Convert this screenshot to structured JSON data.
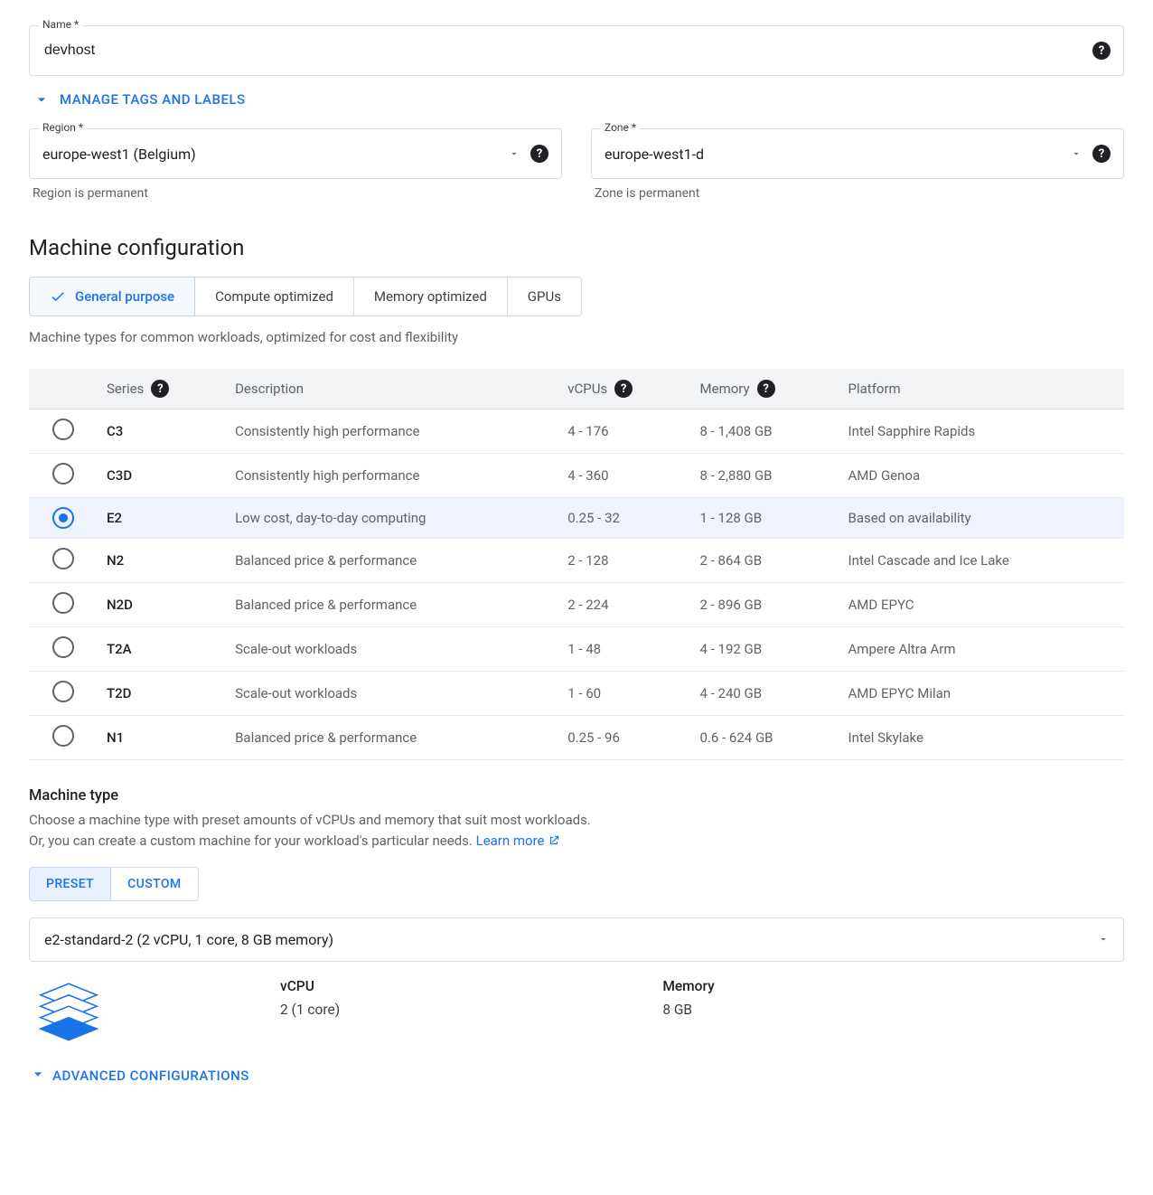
{
  "name_field": {
    "label": "Name",
    "value": "devhost"
  },
  "manage_tags_label": "MANAGE TAGS AND LABELS",
  "region_field": {
    "label": "Region",
    "value": "europe-west1 (Belgium)",
    "helper": "Region is permanent"
  },
  "zone_field": {
    "label": "Zone",
    "value": "europe-west1-d",
    "helper": "Zone is permanent"
  },
  "machine_config_title": "Machine configuration",
  "tabs": {
    "general": "General purpose",
    "compute": "Compute optimized",
    "memory": "Memory optimized",
    "gpus": "GPUs"
  },
  "tab_description": "Machine types for common workloads, optimized for cost and flexibility",
  "table": {
    "headers": {
      "series": "Series",
      "description": "Description",
      "vcpus": "vCPUs",
      "memory": "Memory",
      "platform": "Platform"
    },
    "rows": [
      {
        "series": "C3",
        "desc": "Consistently high performance",
        "vcpus": "4 - 176",
        "memory": "8 - 1,408 GB",
        "platform": "Intel Sapphire Rapids"
      },
      {
        "series": "C3D",
        "desc": "Consistently high performance",
        "vcpus": "4 - 360",
        "memory": "8 - 2,880 GB",
        "platform": "AMD Genoa"
      },
      {
        "series": "E2",
        "desc": "Low cost, day-to-day computing",
        "vcpus": "0.25 - 32",
        "memory": "1 - 128 GB",
        "platform": "Based on availability"
      },
      {
        "series": "N2",
        "desc": "Balanced price & performance",
        "vcpus": "2 - 128",
        "memory": "2 - 864 GB",
        "platform": "Intel Cascade and Ice Lake"
      },
      {
        "series": "N2D",
        "desc": "Balanced price & performance",
        "vcpus": "2 - 224",
        "memory": "2 - 896 GB",
        "platform": "AMD EPYC"
      },
      {
        "series": "T2A",
        "desc": "Scale-out workloads",
        "vcpus": "1 - 48",
        "memory": "4 - 192 GB",
        "platform": "Ampere Altra Arm"
      },
      {
        "series": "T2D",
        "desc": "Scale-out workloads",
        "vcpus": "1 - 60",
        "memory": "4 - 240 GB",
        "platform": "AMD EPYC Milan"
      },
      {
        "series": "N1",
        "desc": "Balanced price & performance",
        "vcpus": "0.25 - 96",
        "memory": "0.6 - 624 GB",
        "platform": "Intel Skylake"
      }
    ],
    "selected_series": "E2"
  },
  "machine_type": {
    "title": "Machine type",
    "desc_line1": "Choose a machine type with preset amounts of vCPUs and memory that suit most workloads.",
    "desc_line2": "Or, you can create a custom machine for your workload's particular needs.",
    "learn_more": "Learn more",
    "preset_label": "PRESET",
    "custom_label": "CUSTOM",
    "selected": "e2-standard-2 (2 vCPU, 1 core, 8 GB memory)",
    "summary": {
      "vcpu_label": "vCPU",
      "vcpu_value": "2 (1 core)",
      "memory_label": "Memory",
      "memory_value": "8 GB"
    }
  },
  "advanced_label": "ADVANCED CONFIGURATIONS"
}
